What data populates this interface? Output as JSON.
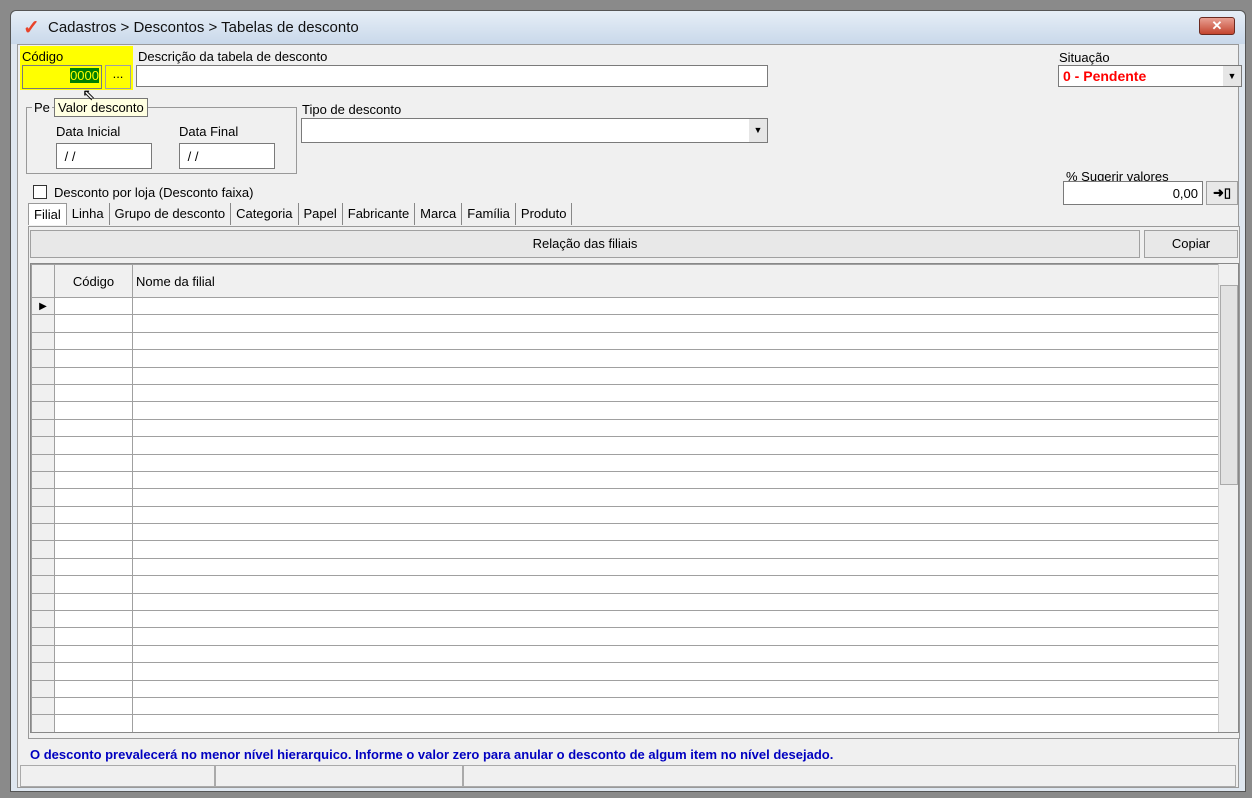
{
  "window": {
    "title": "Cadastros > Descontos > Tabelas de desconto",
    "close_label": "✕"
  },
  "form": {
    "codigo_label": "Código",
    "codigo_value": "0000",
    "lookup_label": "...",
    "tooltip": "Valor desconto",
    "descricao_label": "Descrição da tabela de desconto",
    "descricao_value": "",
    "situacao_label": "Situação",
    "situacao_value": "0 - Pendente",
    "periodo_label": "Pe",
    "data_inicial_label": "Data Inicial",
    "data_inicial_value": " / /",
    "data_final_label": "Data Final",
    "data_final_value": " / /",
    "tipo_label": "Tipo de desconto",
    "tipo_value": "",
    "desconto_loja_label": "Desconto por loja (Desconto faixa)",
    "sugerir_label": "% Sugerir valores",
    "sugerir_value": "0,00"
  },
  "tabs": [
    "Filial",
    "Linha",
    "Grupo de desconto",
    "Categoria",
    "Papel",
    "Fabricante",
    "Marca",
    "Família",
    "Produto"
  ],
  "panel": {
    "header": "Relação das filiais",
    "copy_label": "Copiar",
    "columns": [
      "Código",
      "Nome da filial"
    ]
  },
  "footer_message": "O desconto prevalecerá no menor nível hierarquico. Informe o valor zero para anular o desconto de algum item no nível desejado.",
  "colors": {
    "situacao": "#ff0000",
    "message": "#0000c0",
    "highlight": "#ffff00"
  }
}
